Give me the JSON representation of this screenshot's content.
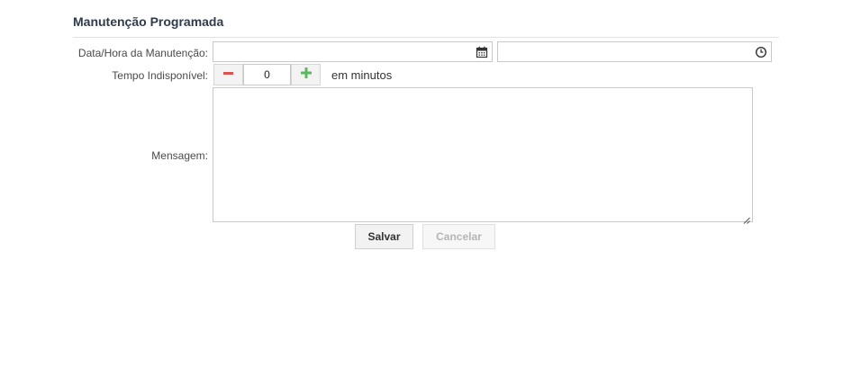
{
  "section": {
    "title": "Manutenção Programada"
  },
  "form": {
    "date_label": "Data/Hora da Manutenção:",
    "date_value": "",
    "time_value": "",
    "downtime_label": "Tempo Indisponível:",
    "downtime_value": "0",
    "downtime_unit": "em minutos",
    "message_label": "Mensagem:",
    "message_value": ""
  },
  "actions": {
    "save_label": "Salvar",
    "cancel_label": "Cancelar"
  },
  "icons": {
    "date": "calendar-icon",
    "time": "clock-icon",
    "decrement": "minus-icon",
    "increment": "plus-icon",
    "resize": "resize-grip-icon"
  },
  "colors": {
    "minus": "#d9534f",
    "plus": "#5cb85c",
    "title": "#2f3a4a",
    "disabled_text": "#b5b5b5"
  }
}
